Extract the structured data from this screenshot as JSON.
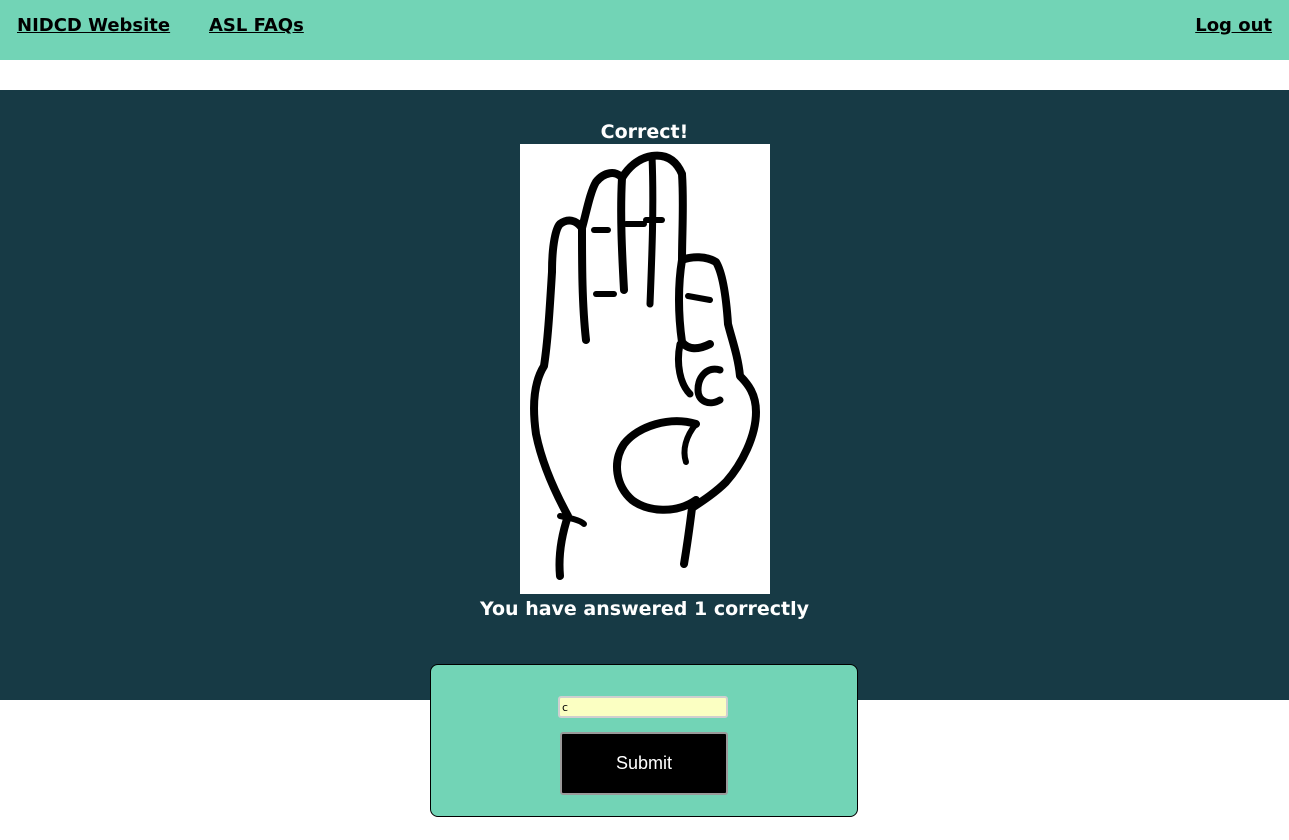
{
  "nav": {
    "nidcd_website": "NIDCD Website",
    "asl_faqs": "ASL FAQs",
    "log_out": "Log out"
  },
  "quiz": {
    "result_message": "Correct!",
    "score_message": "You have answered 1 correctly",
    "sign_image_icon": "hand-sign-icon"
  },
  "form": {
    "answer_value": "c",
    "submit_label": "Submit"
  },
  "colors": {
    "header_bg": "#72d4b6",
    "panel_bg": "#173a45",
    "input_bg": "#fbffc2",
    "button_bg": "#000000"
  }
}
